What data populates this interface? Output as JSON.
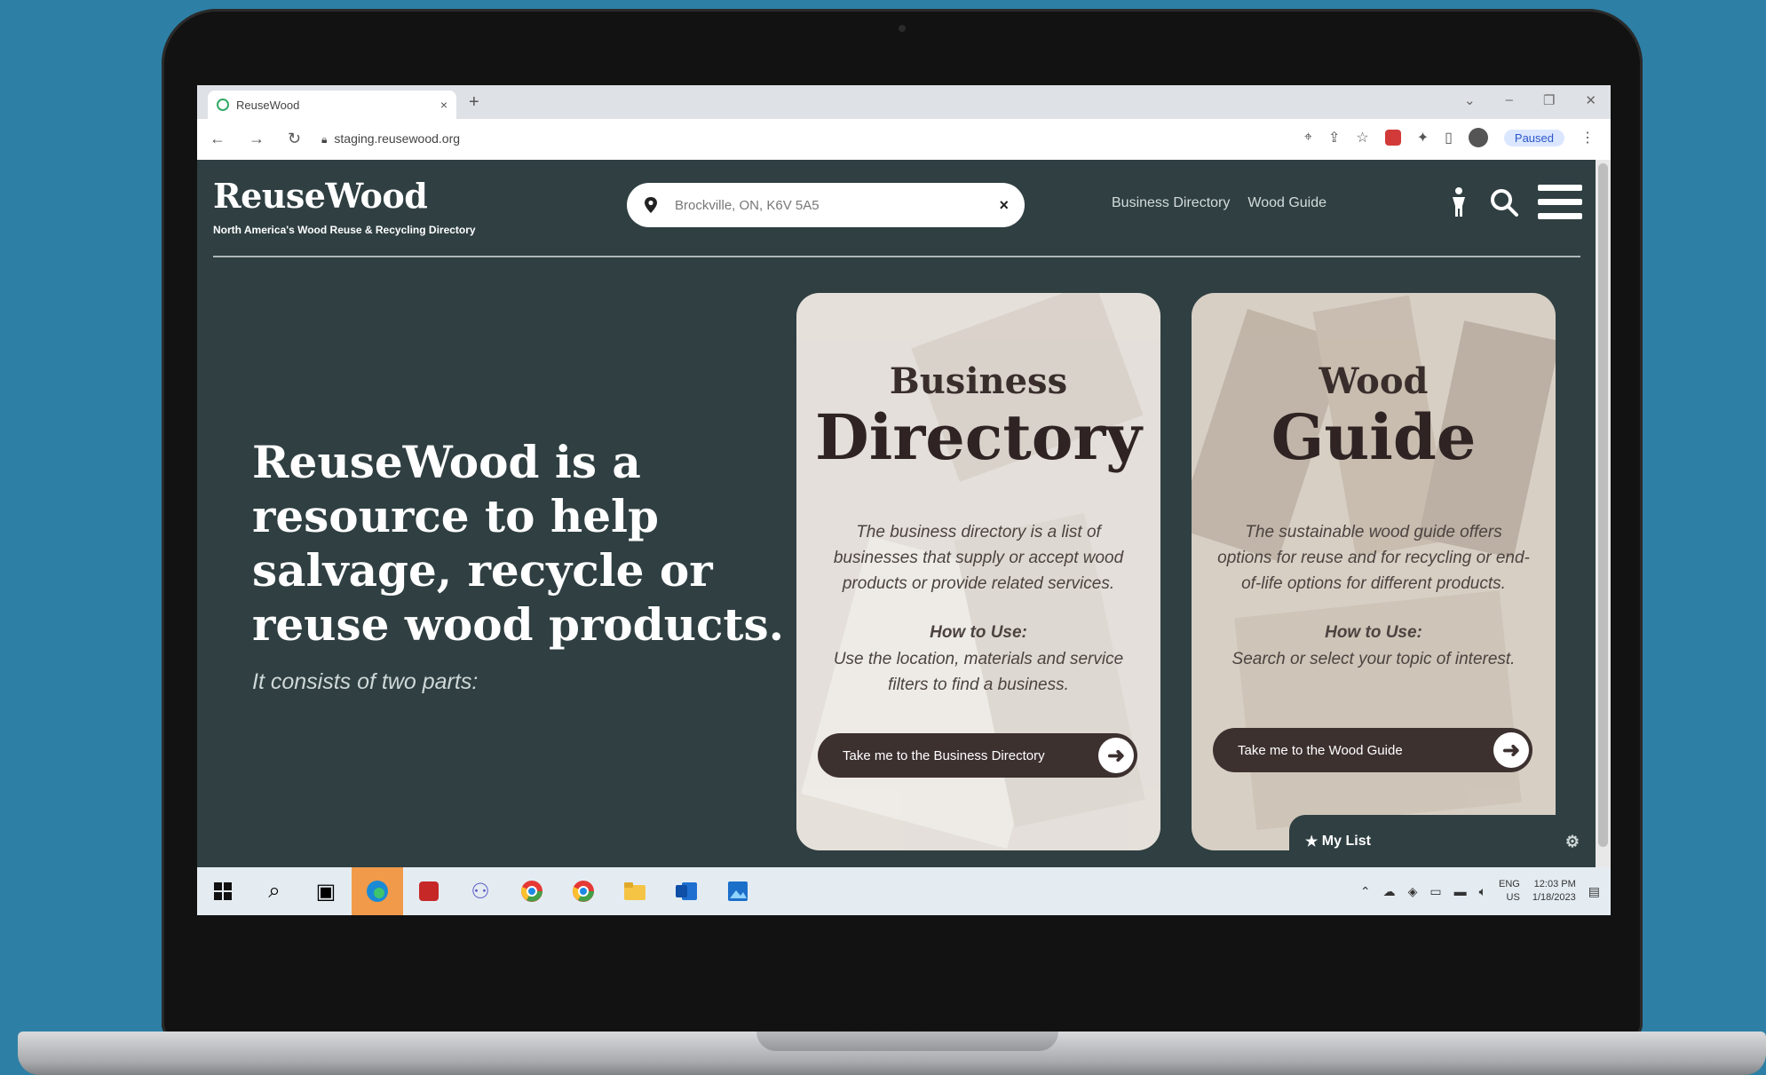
{
  "browser": {
    "tab_title": "ReuseWood",
    "tab_close": "×",
    "new_tab": "+",
    "window_controls": [
      "⌄",
      "–",
      "❐",
      "✕"
    ],
    "url": "staging.reusewood.org",
    "profile_status": "Paused"
  },
  "site": {
    "logo": "ReuseWood",
    "tagline": "North America's Wood Reuse & Recycling Directory",
    "search": {
      "value": "Brockville, ON, K6V 5A5",
      "clear": "×"
    },
    "nav": [
      "Business Directory",
      "Wood Guide"
    ],
    "hero_title": "ReuseWood is a resource to help salvage, recycle or reuse wood products.",
    "hero_sub": "It consists of two parts:"
  },
  "cards": [
    {
      "small_title": "Business",
      "big_title": "Directory",
      "description": "The business directory is a list of businesses that supply or accept wood products or provide related services.",
      "howto_heading": "How to Use:",
      "howto": "Use the location, materials and service filters to find a business.",
      "button": "Take me to the Business Directory"
    },
    {
      "small_title": "Wood",
      "big_title": "Guide",
      "description": "The sustainable wood guide offers options for reuse and for recycling or end-of-life options for different products.",
      "howto_heading": "How to Use:",
      "howto": "Search or select your topic of interest.",
      "button": "Take me to the Wood Guide"
    }
  ],
  "my_list": {
    "label": "My List"
  },
  "taskbar": {
    "language": "ENG",
    "region": "US",
    "time": "12:03 PM",
    "date": "1/18/2023"
  },
  "colors": {
    "site_background": "#2f3f42",
    "button": "#3d3130",
    "outer_background": "#2e7fa5"
  }
}
